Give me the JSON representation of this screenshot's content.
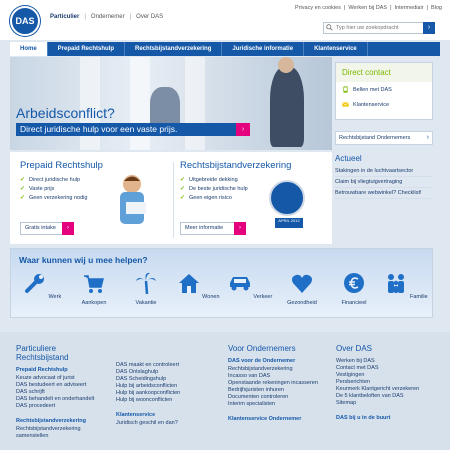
{
  "brand": {
    "logo_text": "DAS",
    "accent": "#1558a8",
    "pink": "#e5007d",
    "green": "#7ab800"
  },
  "audience": {
    "items": [
      "Particulier",
      "Ondernemer",
      "Over DAS"
    ],
    "separator": "|"
  },
  "utility": [
    "Privacy en cookies",
    "|",
    "Werken bij DAS",
    "|",
    "Intermediair",
    "|",
    "Blog"
  ],
  "search": {
    "placeholder": "Typ hier uw zoekopdracht",
    "button": "›"
  },
  "nav": [
    "Home",
    "Prepaid Rechtshulp",
    "Rechtsbijstandverzekering",
    "Juridische informatie",
    "Klantenservice"
  ],
  "hero": {
    "title": "Arbeidsconflict?",
    "subtitle": "Direct juridische hulp voor een vaste prijs.",
    "arrow": "›"
  },
  "contact": {
    "title": "Direct contact",
    "items": [
      "Bellen met DAS",
      "Klantenservice"
    ]
  },
  "rbo_link": {
    "label": "Rechtsbijstand Ondernemers",
    "arrow": "›"
  },
  "actueel": {
    "title": "Actueel",
    "items": [
      "Stakingen in de luchtvaartsector",
      "Claim bij vliegtuigvertraging",
      "Betrouwbare webwinkel? Checklist!"
    ]
  },
  "prepaid": {
    "title": "Prepaid Rechtshulp",
    "checks": [
      "Direct juridische hulp",
      "Vaste prijs",
      "Geen verzekering nodig"
    ],
    "button": "Gratis intake",
    "check_mark": "✓",
    "arrow": "›"
  },
  "rbv": {
    "title": "Rechtsbijstandverzekering",
    "checks": [
      "Uitgebreide dekking",
      "De beste juridische hulp",
      "Geen eigen risico"
    ],
    "button": "Meer informatie",
    "badge_year": "APRIL 2012"
  },
  "help": {
    "title": "Waar kunnen wij u mee helpen?",
    "categories": [
      "Werk",
      "Aankopen",
      "Vakantie",
      "Wonen",
      "Verkeer",
      "Gezondheid",
      "Financieel",
      "Familie"
    ]
  },
  "footer": {
    "particulier": {
      "title": "Particuliere Rechtsbijstand",
      "heading": "Prepaid Rechtshulp",
      "links_a": [
        "Keuze advocaat of jurist",
        "DAS bestudeert en adviseert",
        "DAS schrijft",
        "DAS behandelt en onderhandelt",
        "DAS procedeert"
      ],
      "links_b": [
        "DAS maakt en controleert",
        "DAS Ontslaghulp",
        "DAS Scheidingshulp",
        "Hulp bij arbeidsconflicten",
        "Hulp bij aankoopconflicten",
        "Hulp bij woonconflicten"
      ],
      "heading2": "Rechtsbijstandverzekering",
      "links_c": [
        "Rechtsbijstandverzekering samenstellen"
      ],
      "heading3": "Klantenservice",
      "links_d": [
        "Juridisch geschil en dan?"
      ]
    },
    "ondernemers": {
      "title": "Voor Ondernemers",
      "heading": "DAS voor de Ondernemer",
      "links": [
        "Rechtsbijstandverzekering",
        "Incasso van DAS",
        "Openstaande rekeningen incasseren",
        "Bedrijfsjuristen inhuren",
        "Documenten controleren",
        "Interim specialisten"
      ],
      "heading2": "Klantenservice Ondernemer"
    },
    "over": {
      "title": "Over DAS",
      "links": [
        "Werken bij DAS",
        "Contact met DAS",
        "Vestigingen",
        "Persberichten",
        "Keurmerk Klantgericht verzekeren",
        "De 5 klantbeloften van DAS",
        "Sitemap"
      ],
      "heading2": "DAS bij u in de buurt"
    }
  }
}
